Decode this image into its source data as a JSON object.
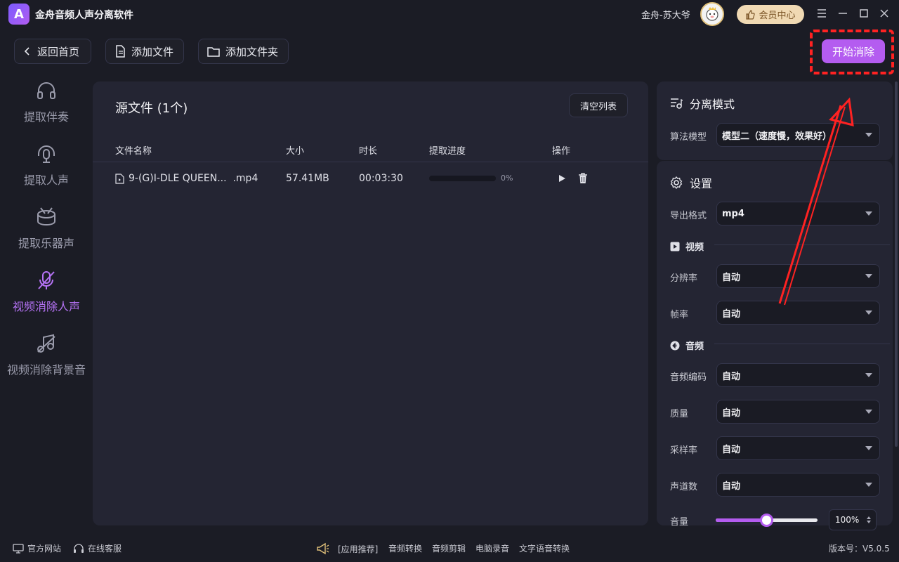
{
  "titlebar": {
    "app_title": "金舟音频人声分离软件",
    "user_name": "金舟-苏大爷",
    "vip_label": "会员中心",
    "logo_letter": "A"
  },
  "toolbar": {
    "back_label": "返回首页",
    "add_file_label": "添加文件",
    "add_folder_label": "添加文件夹",
    "start_label": "开始消除"
  },
  "sidebar": {
    "items": [
      {
        "label": "提取伴奏",
        "icon": "headphones-icon",
        "active": false
      },
      {
        "label": "提取人声",
        "icon": "headset-mic-icon",
        "active": false
      },
      {
        "label": "提取乐器声",
        "icon": "drum-icon",
        "active": false
      },
      {
        "label": "视频消除人声",
        "icon": "mic-off-icon",
        "active": true
      },
      {
        "label": "视频消除背景音",
        "icon": "music-off-icon",
        "active": false
      }
    ]
  },
  "file_panel": {
    "title": "源文件 (1个)",
    "clear_label": "清空列表",
    "columns": [
      "文件名称",
      "大小",
      "时长",
      "提取进度",
      "操作"
    ],
    "rows": [
      {
        "name": "9-(G)I-DLE QUEEN...  .mp4",
        "size": "57.41MB",
        "duration": "00:03:30",
        "progress": 0,
        "progress_label": "0%"
      }
    ]
  },
  "separation": {
    "title": "分离模式",
    "model_label": "算法模型",
    "model_value": "模型二（速度慢，效果好）"
  },
  "settings": {
    "title": "设置",
    "export_format_label": "导出格式",
    "export_format_value": "mp4",
    "video_section": "视频",
    "resolution_label": "分辨率",
    "resolution_value": "自动",
    "framerate_label": "帧率",
    "framerate_value": "自动",
    "audio_section": "音频",
    "audio_codec_label": "音频编码",
    "audio_codec_value": "自动",
    "quality_label": "质量",
    "quality_value": "自动",
    "samplerate_label": "采样率",
    "samplerate_value": "自动",
    "channels_label": "声道数",
    "channels_value": "自动",
    "volume_label": "音量",
    "volume_value": "100",
    "volume_unit": "%",
    "volume_fraction": 0.5
  },
  "footer": {
    "website": "官方网站",
    "support": "在线客服",
    "recommend": "[应用推荐]",
    "links": [
      "音频转换",
      "音频剪辑",
      "电脑录音",
      "文字语音转换"
    ],
    "version": "版本号：V5.0.5"
  },
  "colors": {
    "accent": "#b45cf0",
    "annotation": "#ff2222",
    "background": "#1b1c25",
    "panel": "#242533"
  }
}
